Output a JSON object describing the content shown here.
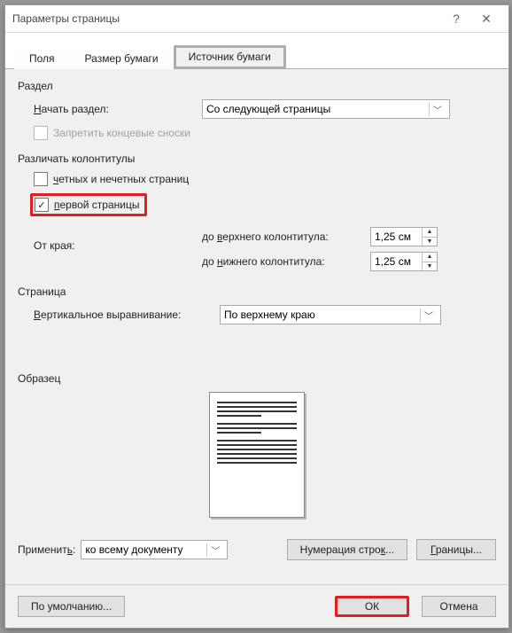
{
  "window": {
    "title": "Параметры страницы"
  },
  "tabs": {
    "t0": "Поля",
    "t1": "Размер бумаги",
    "t2": "Источник бумаги"
  },
  "section": {
    "head": "Раздел",
    "start_label": "Начать раздел:",
    "start_value": "Со следующей страницы",
    "suppress_endnotes": "Запретить концевые сноски"
  },
  "headers": {
    "head": "Различать колонтитулы",
    "odd_even": "четных и нечетных страниц",
    "first_page": "первой страницы",
    "from_edge": "От края:",
    "header_label": "до верхнего колонтитула:",
    "header_value": "1,25 см",
    "footer_label": "до нижнего колонтитула:",
    "footer_value": "1,25 см"
  },
  "page": {
    "head": "Страница",
    "valign_label": "Вертикальное выравнивание:",
    "valign_value": "По верхнему краю"
  },
  "preview": {
    "head": "Образец"
  },
  "apply": {
    "label": "Применить:",
    "value": "ко всему документу"
  },
  "buttons": {
    "line_numbers": "Нумерация строк...",
    "borders": "Границы...",
    "default": "По умолчанию...",
    "ok": "ОК",
    "cancel": "Отмена"
  }
}
